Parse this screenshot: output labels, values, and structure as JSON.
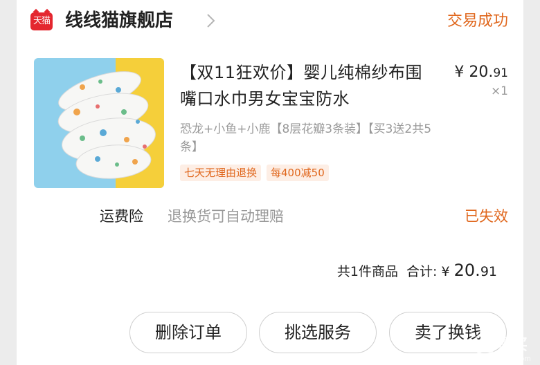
{
  "header": {
    "logo_text": "天猫",
    "shop_name": "线线猫旗舰店",
    "status": "交易成功"
  },
  "product": {
    "title": "【双11狂欢价】婴儿纯棉纱布围嘴口水巾男女宝宝防水",
    "price_symbol": "¥ ",
    "price_main": "20.",
    "price_decimal": "91",
    "quantity": "×1",
    "spec": "恐龙+小鱼+小鹿【8层花瓣3条装】【买3送2共5条】",
    "tags": [
      "七天无理由退换",
      "每400减50"
    ]
  },
  "insurance": {
    "label": "运费险",
    "description": "退换货可自动理赔",
    "status": "已失效"
  },
  "summary": {
    "count_text": "共1件商品",
    "total_label": "合计: ",
    "currency": "¥ ",
    "total_main": "20.",
    "total_decimal": "91"
  },
  "actions": {
    "delete_label": "删除订单",
    "service_label": "挑选服务",
    "sell_label": "卖了换钱"
  },
  "watermark": {
    "text": "值得买",
    "url_text": "fdtdu.com"
  },
  "colors": {
    "accent": "#e0671d",
    "tmall_red": "#e4262f",
    "tag_bg": "#fdeee5",
    "muted": "#999999"
  }
}
